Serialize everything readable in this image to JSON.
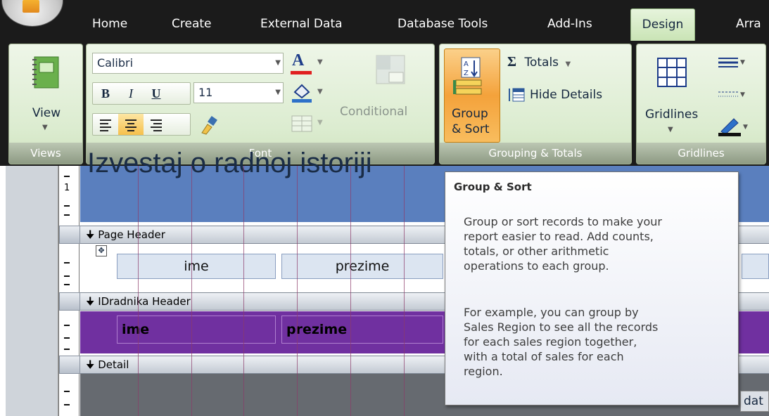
{
  "tabs": [
    "Home",
    "Create",
    "External Data",
    "Database Tools",
    "Add-Ins",
    "Design",
    "Arra"
  ],
  "ribbon": {
    "views": {
      "label": "Views",
      "view_button": "View"
    },
    "font": {
      "label": "Font",
      "font_name": "Calibri",
      "font_size": "11",
      "bold": "B",
      "italic": "I",
      "underline": "U",
      "conditional": "Conditional"
    },
    "grouping": {
      "label": "Grouping & Totals",
      "group_sort_line1": "Group",
      "group_sort_line2": "& Sort",
      "totals": "Totals",
      "hide_details": "Hide Details",
      "sigma": "Σ"
    },
    "gridlines": {
      "label": "Gridlines",
      "gridlines_button": "Gridlines"
    }
  },
  "report": {
    "title_fragment": "Izvestaj o radnoj istoriji",
    "sections": {
      "page_header": "Page Header",
      "id_header": "IDradnika Header",
      "detail": "Detail"
    },
    "page_header_labels": [
      "ime",
      "prezime"
    ],
    "id_header_fields": [
      "ime",
      "prezime"
    ],
    "detail_field_fragment": "dat"
  },
  "ruler_marks": [
    "1"
  ],
  "tooltip": {
    "title": "Group & Sort",
    "body1_lines": [
      "Group or sort records to make your",
      "report easier to read. Add counts,",
      "totals, or other arithmetic",
      "operations to each group."
    ],
    "body2_lines": [
      "For example, you can group by",
      "Sales Region to see all the records",
      "for each sales region together,",
      "with a total of sales for each",
      "region."
    ]
  },
  "colors": {
    "ribbon_bg": "#dcecd0",
    "active_tab": "#c8e3b3",
    "title_band": "#5a7fbe",
    "id_header_band": "#7030a0",
    "group_sort_button": "#f4a23b"
  }
}
